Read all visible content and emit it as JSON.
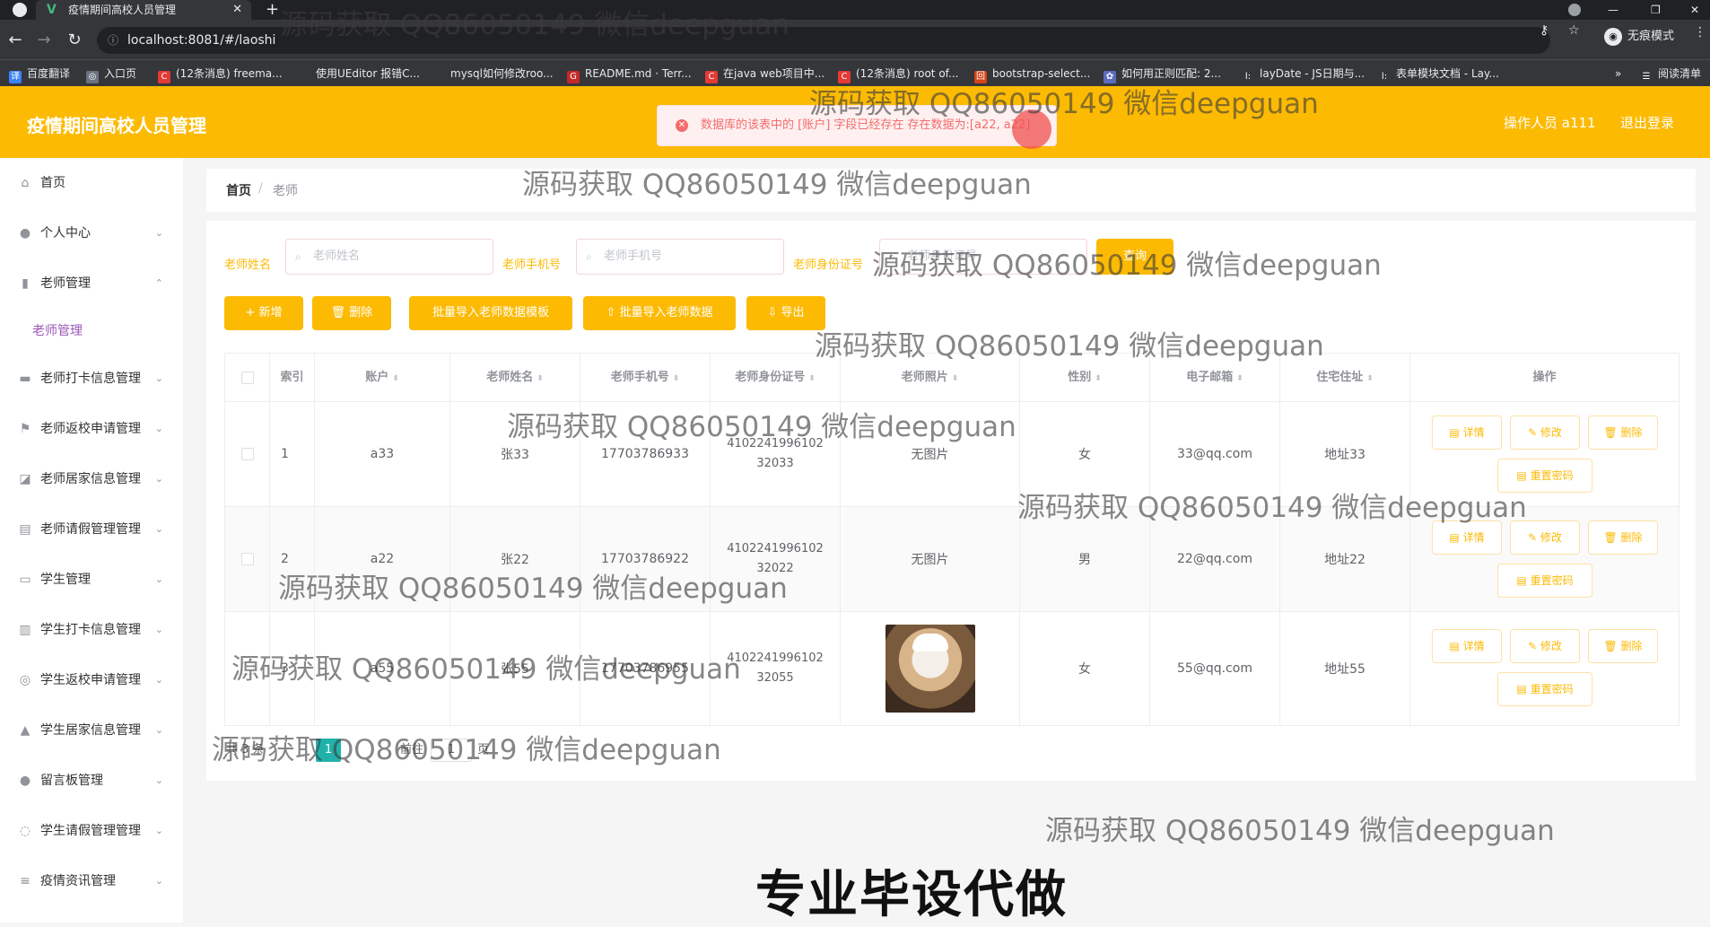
{
  "browser": {
    "tab_title": "疫情期间高校人员管理",
    "tab_favicon": "V",
    "new_tab": "+",
    "url": "localhost:8081/#/laoshi",
    "incognito_label": "无痕模式",
    "bookmarks": [
      {
        "label": "百度翻译",
        "color": "#3b82f6",
        "glyph": "译"
      },
      {
        "label": "入口页",
        "color": "#6b7280",
        "glyph": "◎"
      },
      {
        "label": "(12条消息) freema...",
        "color": "#e53935",
        "glyph": "C"
      },
      {
        "label": "使用UEditor 报错C...",
        "color": "#35363a",
        "glyph": ""
      },
      {
        "label": "mysql如何修改roo...",
        "color": "#35363a",
        "glyph": ""
      },
      {
        "label": "README.md · Terr...",
        "color": "#c62828",
        "glyph": "G"
      },
      {
        "label": "在java web项目中...",
        "color": "#e53935",
        "glyph": "C"
      },
      {
        "label": "(12条消息) root of...",
        "color": "#e53935",
        "glyph": "C"
      },
      {
        "label": "bootstrap-select...",
        "color": "#d84315",
        "glyph": "回"
      },
      {
        "label": "如何用正则匹配: 2...",
        "color": "#5c6bc0",
        "glyph": "✿"
      },
      {
        "label": "layDate - JS日期与...",
        "color": "#35363a",
        "glyph": "l:"
      },
      {
        "label": "表单模块文档 - Lay...",
        "color": "#35363a",
        "glyph": "l:"
      },
      {
        "label": "阅读清单",
        "color": "#35363a",
        "glyph": "☰"
      }
    ],
    "more": "»"
  },
  "header": {
    "title": "疫情期间高校人员管理",
    "operator": "操作人员 a111",
    "logout": "退出登录"
  },
  "toast": {
    "message": "数据库的该表中的 [账户] 字段已经存在 存在数据为:[a22, a22]",
    "icon": "✕"
  },
  "sidebar": {
    "items": [
      {
        "label": "首页",
        "icon": "home-icon",
        "glyph": "⌂",
        "arrow": ""
      },
      {
        "label": "个人中心",
        "icon": "user-icon",
        "glyph": "●",
        "arrow": "⌄"
      },
      {
        "label": "老师管理",
        "icon": "chart-icon",
        "glyph": "▮",
        "arrow": "⌃"
      },
      {
        "label": "老师打卡信息管理",
        "icon": "briefcase-icon",
        "glyph": "▬",
        "arrow": "⌄"
      },
      {
        "label": "老师返校申请管理",
        "icon": "flag-icon",
        "glyph": "⚑",
        "arrow": "⌄"
      },
      {
        "label": "老师居家信息管理",
        "icon": "trend-icon",
        "glyph": "◪",
        "arrow": "⌄"
      },
      {
        "label": "老师请假管理管理",
        "icon": "document-icon",
        "glyph": "▤",
        "arrow": "⌄"
      },
      {
        "label": "学生管理",
        "icon": "monitor-icon",
        "glyph": "▭",
        "arrow": "⌄"
      },
      {
        "label": "学生打卡信息管理",
        "icon": "bars-icon",
        "glyph": "▥",
        "arrow": "⌄"
      },
      {
        "label": "学生返校申请管理",
        "icon": "globe-icon",
        "glyph": "◎",
        "arrow": "⌄"
      },
      {
        "label": "学生居家信息管理",
        "icon": "thumb-icon",
        "glyph": "▲",
        "arrow": "⌄"
      },
      {
        "label": "留言板管理",
        "icon": "person-icon",
        "glyph": "●",
        "arrow": "⌄"
      },
      {
        "label": "学生请假管理管理",
        "icon": "compass-icon",
        "glyph": "◌",
        "arrow": "⌄"
      },
      {
        "label": "疫情资讯管理",
        "icon": "menu-icon",
        "glyph": "≡",
        "arrow": "⌄"
      }
    ],
    "sub_active": "老师管理"
  },
  "breadcrumb": {
    "home": "首页",
    "separator": "/",
    "current": "老师"
  },
  "search": {
    "name_label": "老师姓名",
    "name_placeholder": "老师姓名",
    "phone_label": "老师手机号",
    "phone_placeholder": "老师手机号",
    "id_label": "老师身份证号",
    "id_placeholder": "老师身份证号",
    "button": "查询"
  },
  "toolbar": {
    "add": "+ 新增",
    "delete": "🗑 删除",
    "import_template": "批量导入老师数据模板",
    "import_data": "⇧ 批量导入老师数据",
    "export": "⇩ 导出"
  },
  "table": {
    "columns": [
      "索引",
      "账户",
      "老师姓名",
      "老师手机号",
      "老师身份证号",
      "老师照片",
      "性别",
      "电子邮箱",
      "住宅住址",
      "操作"
    ],
    "sort_glyph": "⬍",
    "rows": [
      {
        "index": "1",
        "account": "a33",
        "name": "张33",
        "phone": "17703786933",
        "idno": "410224199610232033",
        "photo": "无图片",
        "gender": "女",
        "email": "33@qq.com",
        "address": "地址33",
        "has_photo": false
      },
      {
        "index": "2",
        "account": "a22",
        "name": "张22",
        "phone": "17703786922",
        "idno": "410224199610232022",
        "photo": "无图片",
        "gender": "男",
        "email": "22@qq.com",
        "address": "地址22",
        "has_photo": false
      },
      {
        "index": "3",
        "account": "a55",
        "name": "张55",
        "phone": "17703786955",
        "idno": "410224199610232055",
        "photo": "",
        "gender": "女",
        "email": "55@qq.com",
        "address": "地址55",
        "has_photo": true
      }
    ],
    "actions": {
      "detail": "▤ 详情",
      "edit": "✎ 修改",
      "delete": "🗑 删除",
      "reset": "▤ 重置密码"
    }
  },
  "pager": {
    "total": "共 3 条",
    "current_page": "1",
    "goto_label": "前往",
    "goto_value": "1",
    "page_suffix": "页"
  },
  "overlay": {
    "watermark": "源码获取 QQ86050149 微信deepguan",
    "banner": "专业毕设代做"
  }
}
